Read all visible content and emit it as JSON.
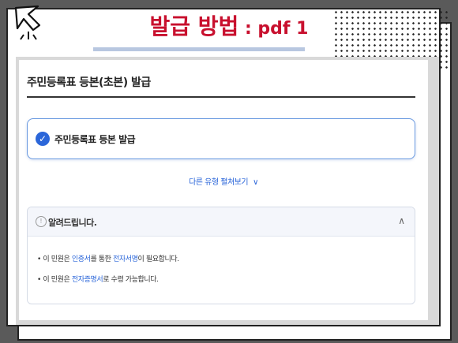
{
  "slide": {
    "title_main": "발급 방법",
    "title_suffix": " : pdf 1"
  },
  "section": {
    "title": "주민등록표 등본(초본) 발급"
  },
  "option": {
    "label": "주민등록표 등본 발급",
    "selected": true
  },
  "more_link": {
    "label": "다른 유형 펼쳐보기",
    "chevron": "∨"
  },
  "notice": {
    "title": "알려드립니다.",
    "toggle": "∧",
    "lines": [
      {
        "prefix": "• 이 민원은 ",
        "hl1": "인증서",
        "mid": "를 통한 ",
        "hl2": "전자서명",
        "suffix": "이 필요합니다."
      },
      {
        "prefix": "• 이 민원은 ",
        "hl1": "전자증명서",
        "mid": "로 수령 가능합니다.",
        "hl2": "",
        "suffix": ""
      }
    ]
  },
  "colors": {
    "title_red": "#c8102e",
    "link_blue": "#2b66d9"
  }
}
